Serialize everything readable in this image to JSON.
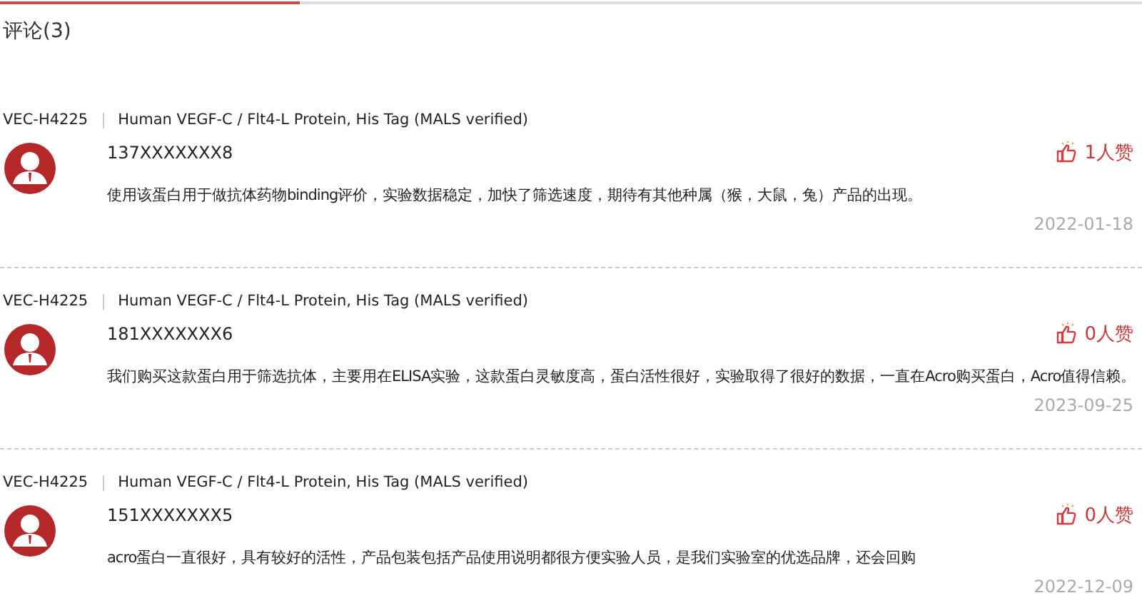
{
  "title": "评论(3)",
  "comments": [
    {
      "sku": "VEC-H4225",
      "product": "Human VEGF-C / Flt4-L Protein, His Tag (MALS verified)",
      "user": "137XXXXXXX8",
      "likes": "1人赞",
      "text": "使用该蛋白用于做抗体药物binding评价，实验数据稳定，加快了筛选速度，期待有其他种属（猴，大鼠，兔）产品的出现。",
      "date": "2022-01-18"
    },
    {
      "sku": "VEC-H4225",
      "product": "Human VEGF-C / Flt4-L Protein, His Tag (MALS verified)",
      "user": "181XXXXXXX6",
      "likes": "0人赞",
      "text": "我们购买这款蛋白用于筛选抗体，主要用在ELISA实验，这款蛋白灵敏度高，蛋白活性很好，实验取得了很好的数据，一直在Acro购买蛋白，Acro值得信赖。",
      "date": "2023-09-25"
    },
    {
      "sku": "VEC-H4225",
      "product": "Human VEGF-C / Flt4-L Protein, His Tag (MALS verified)",
      "user": "151XXXXXXX5",
      "likes": "0人赞",
      "text": "acro蛋白一直很好，具有较好的活性，产品包装包括产品使用说明都很方便实验人员，是我们实验室的优选品牌，还会回购",
      "date": "2022-12-09"
    }
  ]
}
